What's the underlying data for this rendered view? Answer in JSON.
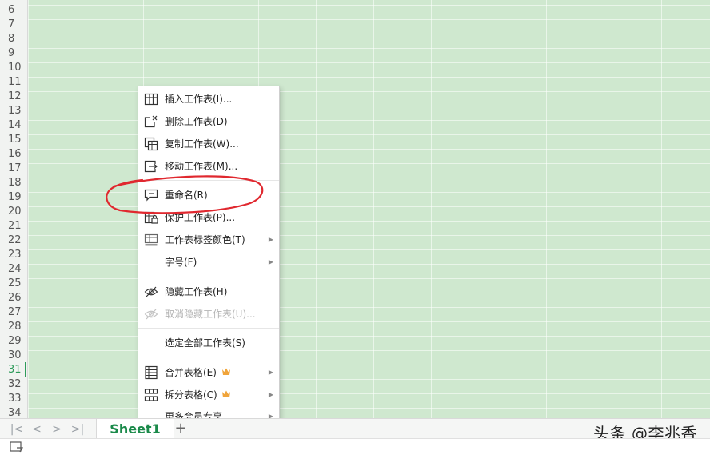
{
  "rows": [
    "6",
    "7",
    "8",
    "9",
    "10",
    "11",
    "12",
    "13",
    "14",
    "15",
    "16",
    "17",
    "18",
    "19",
    "20",
    "21",
    "22",
    "23",
    "24",
    "25",
    "26",
    "27",
    "28",
    "29",
    "30",
    "31",
    "32",
    "33",
    "34"
  ],
  "active_row": "31",
  "sheet_tabs": {
    "active_label": "Sheet1",
    "add_label": "+"
  },
  "nav": {
    "first": "|<",
    "prev": "<",
    "next": ">",
    "last": ">|"
  },
  "context_menu": {
    "items": [
      {
        "label": "插入工作表(I)...",
        "icon": "insert-sheet-icon"
      },
      {
        "label": "删除工作表(D)",
        "icon": "delete-sheet-icon"
      },
      {
        "label": "复制工作表(W)...",
        "icon": "copy-sheet-icon"
      },
      {
        "label": "移动工作表(M)...",
        "icon": "move-sheet-icon"
      },
      {
        "label": "重命名(R)",
        "icon": "rename-icon"
      },
      {
        "label": "保护工作表(P)...",
        "icon": "protect-sheet-icon"
      },
      {
        "label": "工作表标签颜色(T)",
        "icon": "tab-color-icon"
      },
      {
        "label": "字号(F)"
      },
      {
        "label": "隐藏工作表(H)",
        "icon": "hide-eye-icon"
      },
      {
        "label": "取消隐藏工作表(U)...",
        "icon": "unhide-eye-icon",
        "disabled": true
      },
      {
        "label": "选定全部工作表(S)"
      },
      {
        "label": "合并表格(E)",
        "icon": "merge-table-icon",
        "premium": true
      },
      {
        "label": "拆分表格(C)",
        "icon": "split-table-icon",
        "premium": true
      },
      {
        "label": "更多会员专享"
      }
    ]
  },
  "watermark": "头条 @李兆香",
  "colors": {
    "grid_bg": "#cfe8cf",
    "accent": "#2e9b5a",
    "annotation": "#e0282f",
    "crown": "#f0a43a"
  }
}
